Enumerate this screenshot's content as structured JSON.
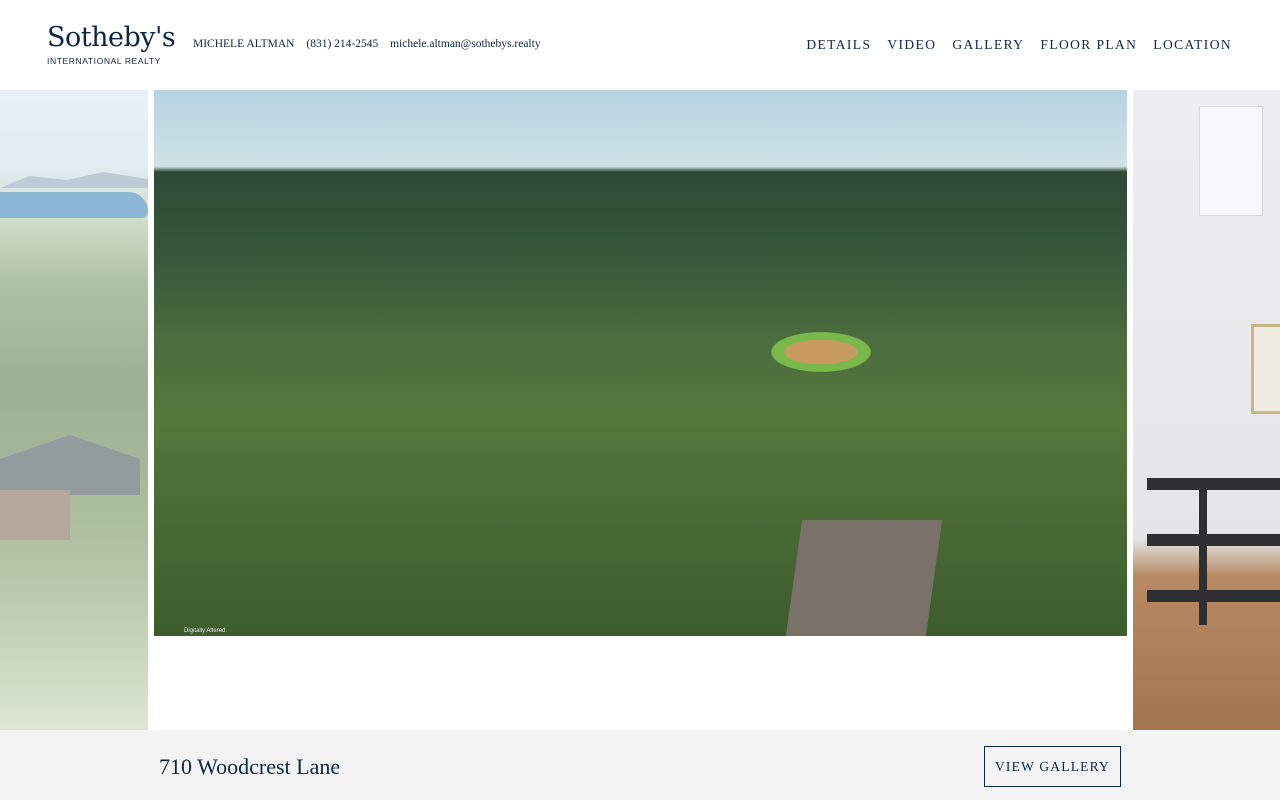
{
  "brand": {
    "name": "Sotheby's",
    "subtitle": "INTERNATIONAL REALTY"
  },
  "contact": {
    "agent": "MICHELE ALTMAN",
    "phone": "(831) 214-2545",
    "email": "michele.altman@sothebys.realty"
  },
  "nav": {
    "items": [
      {
        "label": "DETAILS"
      },
      {
        "label": "VIDEO"
      },
      {
        "label": "GALLERY"
      },
      {
        "label": "FLOOR PLAN"
      },
      {
        "label": "LOCATION"
      }
    ]
  },
  "hero": {
    "watermark": "Digitally Altered"
  },
  "footer": {
    "address": "710 Woodcrest Lane",
    "gallery_button": "VIEW GALLERY"
  },
  "colors": {
    "brand_navy": "#0f2547",
    "footer_bg": "#f3f3f3"
  }
}
